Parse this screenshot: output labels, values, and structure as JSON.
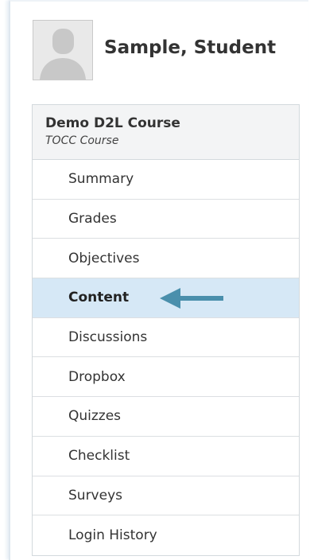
{
  "profile": {
    "name": "Sample, Student"
  },
  "course": {
    "title": "Demo D2L Course",
    "subtitle": "TOCC Course"
  },
  "nav": {
    "items": [
      {
        "label": "Summary"
      },
      {
        "label": "Grades"
      },
      {
        "label": "Objectives"
      },
      {
        "label": "Content"
      },
      {
        "label": "Discussions"
      },
      {
        "label": "Dropbox"
      },
      {
        "label": "Quizzes"
      },
      {
        "label": "Checklist"
      },
      {
        "label": "Surveys"
      },
      {
        "label": "Login History"
      }
    ],
    "active_label": "Content"
  },
  "colors": {
    "active_background": "#d6e8f6",
    "arrow": "#4a8fac",
    "header_background": "#f3f4f5"
  },
  "icons": {
    "avatar": "user-silhouette-icon",
    "pointer": "left-arrow-icon"
  }
}
